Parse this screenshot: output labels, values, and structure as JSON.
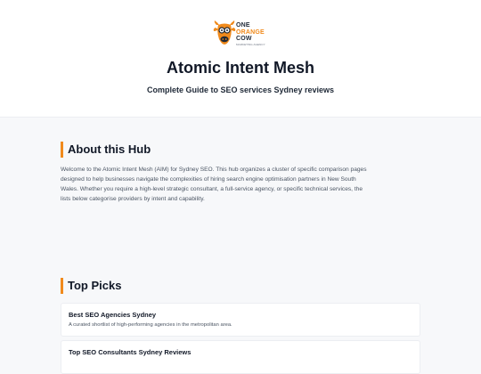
{
  "brand": {
    "line1": "ONE",
    "line2": "ORANGE",
    "line3": "COW",
    "tagline": "MARKETING AGENCY",
    "accent": "#f08a1c",
    "icon": "cow-head-icon"
  },
  "header": {
    "title": "Atomic Intent Mesh",
    "subtitle": "Complete Guide to SEO services Sydney reviews"
  },
  "about": {
    "heading": "About this Hub",
    "text": "Welcome to the Atomic Intent Mesh (AIM) for Sydney SEO. This hub organizes a cluster of specific comparison pages designed to help businesses navigate the complexities of hiring search engine optimisation partners in New South Wales. Whether you require a high-level strategic consultant, a full-service agency, or specific technical services, the lists below categorise providers by intent and capability."
  },
  "top_picks": {
    "heading": "Top Picks",
    "items": [
      {
        "title": "Best SEO Agencies Sydney",
        "description": "A curated shortlist of high-performing agencies in the metropolitan area."
      },
      {
        "title": "Top SEO Consultants Sydney Reviews",
        "description": ""
      }
    ]
  }
}
